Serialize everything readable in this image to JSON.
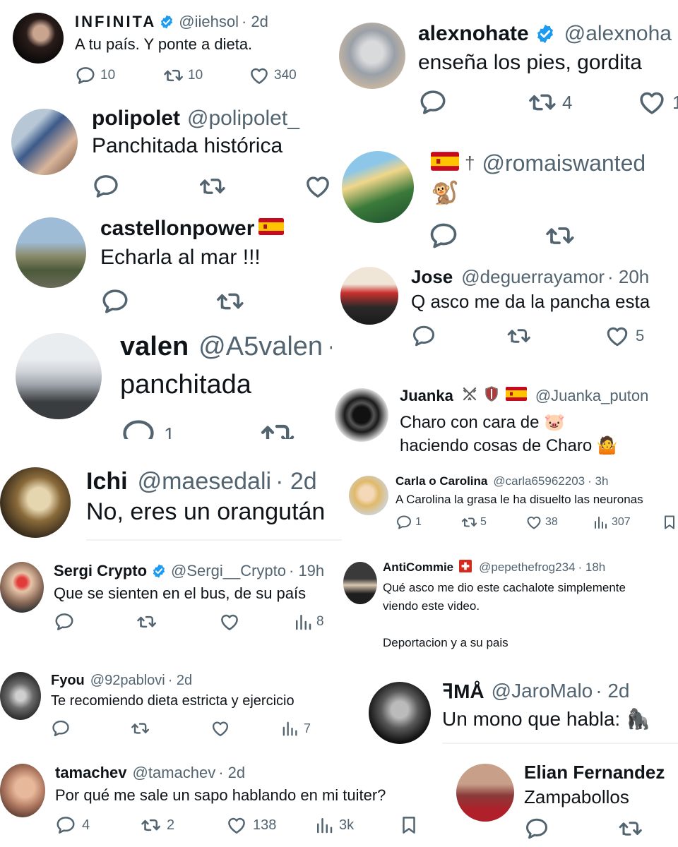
{
  "tweets": [
    {
      "name": "INFINITA",
      "handle": "@iiehsol",
      "time": "· 2d",
      "text": "A tu país. Y ponte a dieta.",
      "replies": "10",
      "reposts": "10",
      "likes": "340"
    },
    {
      "name": "alexnohate",
      "handle": "@alexnoha",
      "text": "enseña los pies, gordita",
      "reposts": "4",
      "likes": "1"
    },
    {
      "name": "polipolet",
      "handle": "@polipolet_",
      "text": "Panchitada histórica"
    },
    {
      "name": "",
      "handle": "@romaiswanted",
      "text": "🐒"
    },
    {
      "name": "castellonpower",
      "text": "Echarla al mar !!!"
    },
    {
      "name": "Jose",
      "handle": "@deguerrayamor",
      "time": "· 20h",
      "text": "Q asco me da la pancha esta",
      "likes": "5"
    },
    {
      "name": "valen",
      "handle": "@A5valen",
      "time": "·",
      "text": "panchitada",
      "replies": "1"
    },
    {
      "name": "Juanka",
      "handle": "@Juanka_puton",
      "text": "Charo con cara de 🐷\nhaciendo cosas de Charo 🤷"
    },
    {
      "name": "Carla o Carolina",
      "handle": "@carla65962203",
      "time": "· 3h",
      "text": "A Carolina la grasa le ha disuelto las neuronas",
      "replies": "1",
      "reposts": "5",
      "likes": "38",
      "views": "307"
    },
    {
      "name": "Ichi",
      "handle": "@maesedali",
      "time": "· 2d",
      "text": "No, eres un orangután"
    },
    {
      "name": "Sergi Crypto",
      "handle": "@Sergi__Crypto",
      "time": "· 19h",
      "text": "Que se sienten en el bus, de su país",
      "views": "8"
    },
    {
      "name": "AntiCommie",
      "handle": "@pepethefrog234",
      "time": "· 18h",
      "text": "Qué asco me dio este cachalote simplemente\nviendo este video.\n\nDeportacion y a su pais"
    },
    {
      "name": "Fyou",
      "handle": "@92pablovi",
      "time": "· 2d",
      "text": "Te recomiendo dieta estricta y ejercicio",
      "views": "7"
    },
    {
      "name": "ꟻMÅ",
      "handle": "@JaroMalo",
      "time": "· 2d",
      "text": "Un mono que habla: 🦍"
    },
    {
      "name": "tamachev",
      "handle": "@tamachev",
      "time": "· 2d",
      "text": "Por qué me sale un sapo hablando en mi tuiter?",
      "replies": "4",
      "reposts": "2",
      "likes": "138",
      "views": "3k"
    },
    {
      "name": "Elian Fernandez",
      "text": "Zampabollos"
    }
  ],
  "colors": {
    "verified": "#1d9bf0",
    "name": "#0f1419",
    "muted": "#536471",
    "divider": "#eff3f4"
  },
  "icons": [
    "reply-icon",
    "repost-icon",
    "like-icon",
    "views-icon",
    "bookmark-icon",
    "verified-badge-icon",
    "spain-flag-icon",
    "switzerland-flag-icon",
    "crossed-swords-icon",
    "shield-icon"
  ]
}
